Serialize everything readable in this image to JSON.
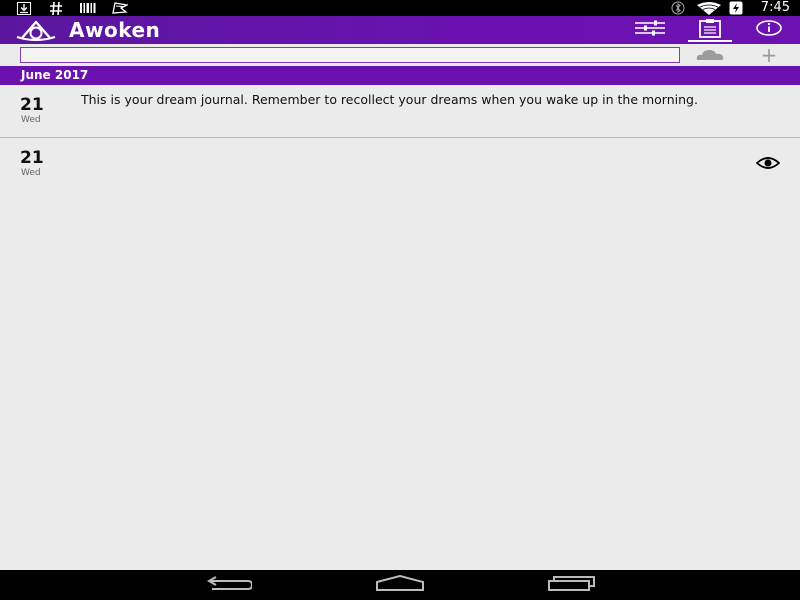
{
  "status_bar": {
    "time": "7:45",
    "left_icons": [
      "download-icon",
      "hash-icon",
      "barcode-icon",
      "flag-icon"
    ],
    "right_icons": [
      "bluetooth-icon",
      "wifi-icon",
      "battery-charging-icon"
    ]
  },
  "app_bar": {
    "title": "Awoken",
    "actions": [
      "settings-sliders-icon",
      "clipboard-icon",
      "info-icon"
    ],
    "active_action": "clipboard-icon"
  },
  "search": {
    "value": "",
    "placeholder": ""
  },
  "toolbar": {
    "add_label": "+"
  },
  "journal": {
    "month_header": "June 2017",
    "entries": [
      {
        "day": "21",
        "weekday": "Wed",
        "text": "This is your dream journal. Remember to recollect your dreams when you wake up in the morning."
      },
      {
        "day": "21",
        "weekday": "Wed",
        "text": ""
      }
    ]
  },
  "colors": {
    "primary": "#6a12b0",
    "background": "#ebebeb",
    "status_bar": "#000000"
  }
}
